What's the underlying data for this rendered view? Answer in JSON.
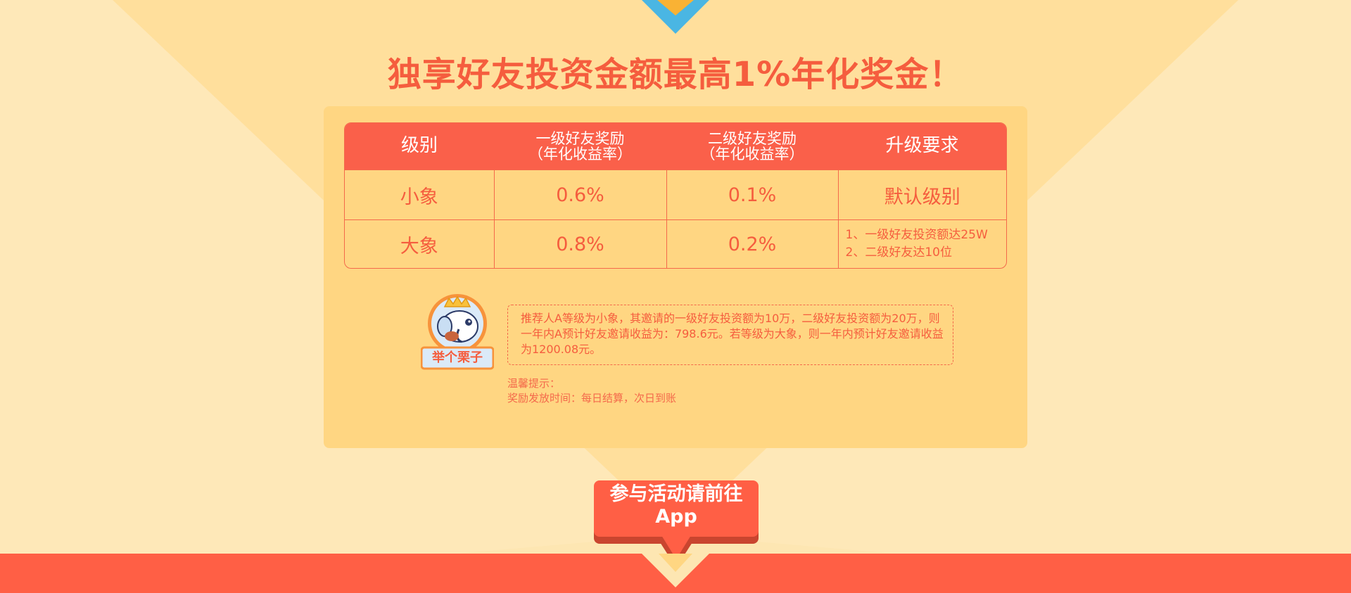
{
  "headline": "独享好友投资金额最高1%年化奖金！",
  "table": {
    "headers": {
      "level": "级别",
      "first_line1": "一级好友奖励",
      "first_line2": "（年化收益率）",
      "second_line1": "二级好友奖励",
      "second_line2": "（年化收益率）",
      "upgrade": "升级要求"
    },
    "rows": [
      {
        "level": "小象",
        "first": "0.6%",
        "second": "0.1%",
        "upgrade": "默认级别"
      },
      {
        "level": "大象",
        "first": "0.8%",
        "second": "0.2%",
        "upgrade_line1": "1、一级好友投资额达25W",
        "upgrade_line2": "2、二级好友达10位"
      }
    ]
  },
  "example": {
    "badge": "举个栗子",
    "text": "推荐人A等级为小象，其邀请的一级好友投资额为10万，二级好友投资额为20万，则一年内A预计好友邀请收益为：798.6元。若等级为大象，则一年内预计好友邀请收益为1200.08元。"
  },
  "tips": {
    "title": "温馨提示：",
    "line1": "奖励发放时间：每日结算，次日到账"
  },
  "cta": {
    "line1": "参与活动请前往",
    "line2": "App"
  },
  "colors": {
    "background": "#fde6b2",
    "panel": "#ffd682",
    "accent": "#f55d3e",
    "header": "#fa604a",
    "footer": "#ff5f45",
    "arrow_blue": "#4ab6e3"
  }
}
